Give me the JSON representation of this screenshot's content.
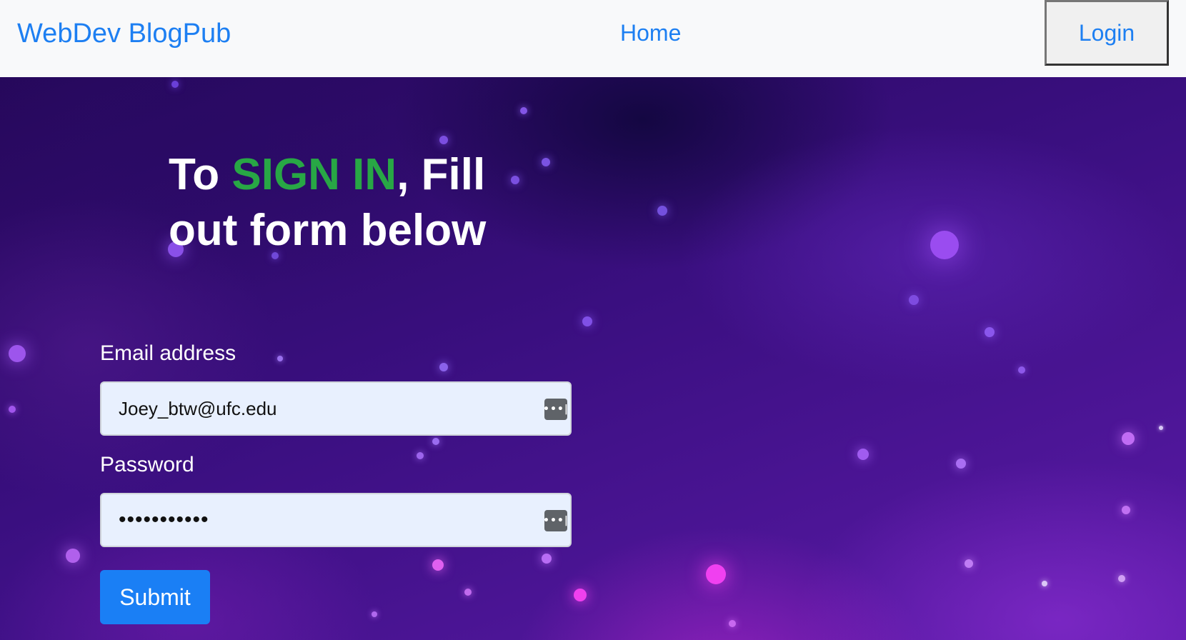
{
  "navbar": {
    "brand": "WebDev BlogPub",
    "home_label": "Home",
    "login_label": "Login"
  },
  "hero": {
    "heading_prefix": "To ",
    "heading_accent": "SIGN IN",
    "heading_suffix_line1": ", Fill",
    "heading_line2": "out form below"
  },
  "form": {
    "email_label": "Email address",
    "email_value": "Joey_btw@ufc.edu",
    "password_label": "Password",
    "password_value": "•••••••••••",
    "password_manager_icon": "password-manager-icon",
    "submit_label": "Submit"
  },
  "colors": {
    "link_blue": "#1d7ff2",
    "accent_green": "#28a745",
    "button_blue": "#1a7ff5",
    "navbar_bg": "#f8f9fa"
  }
}
